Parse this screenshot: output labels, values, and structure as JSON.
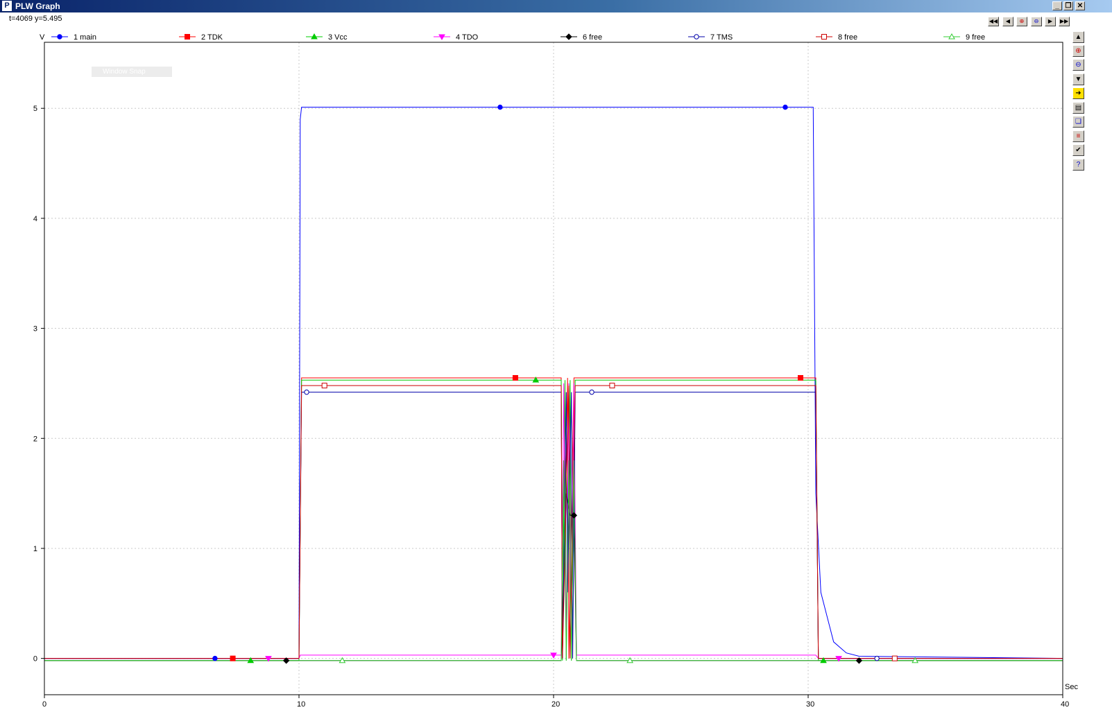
{
  "window": {
    "title": "PLW Graph",
    "icon": "plw-logo-icon",
    "buttons": [
      "minimize-icon",
      "restore-icon",
      "close-icon"
    ]
  },
  "readout": "t=4069 y=5.495",
  "nav_buttons": [
    "first-icon",
    "previous-icon",
    "zoom-in-icon",
    "zoom-out-icon",
    "next-icon",
    "last-icon"
  ],
  "side_buttons": [
    "scroll-up-icon",
    "zoom-in-icon",
    "zoom-out-icon",
    "scroll-down-icon",
    "export-icon",
    "save-icon",
    "copy-icon",
    "channels-icon",
    "check-icon",
    "help-icon"
  ],
  "snap_label": "Window Snap",
  "chart_data": {
    "type": "line",
    "ylabel": "V",
    "xlabel": "Sec",
    "xlim": [
      0,
      40
    ],
    "ylim": [
      -0.33,
      5.6
    ],
    "xticks": [
      0,
      10,
      20,
      30,
      40
    ],
    "yticks": [
      0,
      1,
      2,
      3,
      4,
      5
    ],
    "grid": true,
    "legend_position": "top",
    "series": [
      {
        "name": "1 main",
        "color": "#0000ff",
        "marker": "circle-filled",
        "points": [
          [
            0,
            0
          ],
          [
            10,
            0
          ],
          [
            10.05,
            4.9
          ],
          [
            10.1,
            5.01
          ],
          [
            30.2,
            5.01
          ],
          [
            30.3,
            1.5
          ],
          [
            30.5,
            0.6
          ],
          [
            31,
            0.15
          ],
          [
            31.5,
            0.05
          ],
          [
            32,
            0.02
          ],
          [
            40,
            0.0
          ]
        ],
        "marker_x": [
          6.7,
          17.9,
          29.1
        ]
      },
      {
        "name": "2 TDK",
        "color": "#ff0000",
        "marker": "square-filled",
        "points": [
          [
            0,
            0
          ],
          [
            10,
            0
          ],
          [
            10.1,
            2.55
          ],
          [
            20.3,
            2.55
          ],
          [
            20.35,
            0
          ],
          [
            20.55,
            2.55
          ],
          [
            20.6,
            0
          ],
          [
            20.8,
            2.55
          ],
          [
            20.85,
            2.55
          ],
          [
            30.3,
            2.55
          ],
          [
            30.4,
            0
          ],
          [
            40,
            0
          ]
        ],
        "marker_x": [
          7.4,
          18.5,
          29.7
        ]
      },
      {
        "name": "3 Vcc",
        "color": "#00cc00",
        "marker": "triangle-up-filled",
        "points": [
          [
            0,
            -0.02
          ],
          [
            10,
            -0.02
          ],
          [
            10.1,
            2.53
          ],
          [
            20.3,
            2.53
          ],
          [
            20.35,
            -0.02
          ],
          [
            20.45,
            2.53
          ],
          [
            20.5,
            -0.02
          ],
          [
            20.65,
            2.53
          ],
          [
            20.7,
            -0.02
          ],
          [
            20.85,
            2.53
          ],
          [
            30.3,
            2.53
          ],
          [
            30.4,
            -0.02
          ],
          [
            40,
            -0.02
          ]
        ],
        "marker_x": [
          8.1,
          19.3,
          30.6
        ]
      },
      {
        "name": "4 TDO",
        "color": "#ff00ff",
        "marker": "triangle-down-filled",
        "points": [
          [
            0,
            0
          ],
          [
            10,
            0
          ],
          [
            10.05,
            0.03
          ],
          [
            20.3,
            0.03
          ],
          [
            20.4,
            2.5
          ],
          [
            20.5,
            0.03
          ],
          [
            20.6,
            2.5
          ],
          [
            20.7,
            0.03
          ],
          [
            20.8,
            2.5
          ],
          [
            20.9,
            0.03
          ],
          [
            30.3,
            0.03
          ],
          [
            30.4,
            0
          ],
          [
            40,
            0
          ]
        ],
        "marker_x": [
          8.8,
          20.0,
          31.2
        ]
      },
      {
        "name": "6 free",
        "color": "#000000",
        "marker": "diamond-filled",
        "points": [
          [
            0,
            -0.02
          ],
          [
            10,
            -0.02
          ],
          [
            20.3,
            -0.02
          ],
          [
            20.5,
            1.5
          ],
          [
            20.65,
            1.3
          ],
          [
            20.8,
            1.3
          ],
          [
            20.9,
            -0.02
          ],
          [
            40,
            -0.02
          ]
        ],
        "marker_x": [
          9.5,
          20.8,
          32.0
        ]
      },
      {
        "name": "7 TMS",
        "color": "#0000aa",
        "marker": "circle-open",
        "points": [
          [
            0,
            0
          ],
          [
            10,
            0
          ],
          [
            10.1,
            2.42
          ],
          [
            20.3,
            2.42
          ],
          [
            20.35,
            0
          ],
          [
            20.5,
            2.42
          ],
          [
            20.55,
            0.6
          ],
          [
            20.7,
            2.42
          ],
          [
            20.75,
            0
          ],
          [
            20.85,
            2.42
          ],
          [
            30.3,
            2.42
          ],
          [
            30.4,
            0
          ],
          [
            40,
            0
          ]
        ],
        "marker_x": [
          10.3,
          21.5,
          32.7
        ]
      },
      {
        "name": "8 free",
        "color": "#cc0000",
        "marker": "square-open",
        "points": [
          [
            0,
            0
          ],
          [
            10,
            0
          ],
          [
            10.1,
            2.48
          ],
          [
            20.3,
            2.48
          ],
          [
            20.35,
            0
          ],
          [
            20.6,
            2.48
          ],
          [
            20.65,
            0
          ],
          [
            20.85,
            2.48
          ],
          [
            30.3,
            2.48
          ],
          [
            30.4,
            0
          ],
          [
            40,
            0
          ]
        ],
        "marker_x": [
          11.0,
          22.3,
          33.4
        ]
      },
      {
        "name": "9 free",
        "color": "#33cc33",
        "marker": "triangle-up-open",
        "points": [
          [
            0,
            -0.02
          ],
          [
            10,
            -0.02
          ],
          [
            20.3,
            -0.02
          ],
          [
            20.4,
            1.8
          ],
          [
            20.5,
            -0.02
          ],
          [
            20.6,
            1.8
          ],
          [
            20.7,
            -0.02
          ],
          [
            20.8,
            1.8
          ],
          [
            20.9,
            -0.02
          ],
          [
            40,
            -0.02
          ]
        ],
        "marker_x": [
          11.7,
          23.0,
          34.2
        ]
      }
    ]
  }
}
